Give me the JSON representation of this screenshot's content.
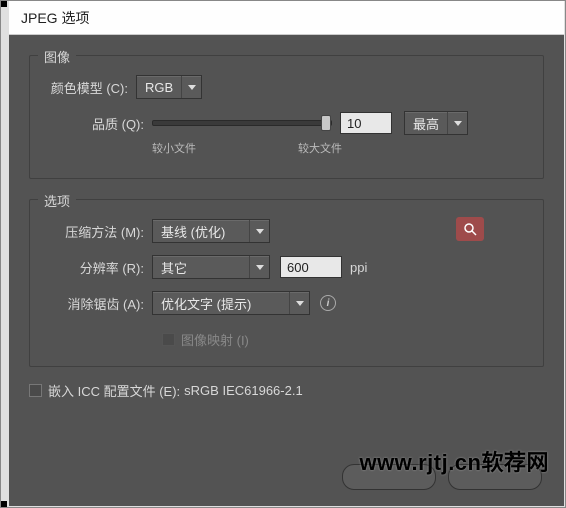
{
  "title": "JPEG 选项",
  "image_section": {
    "legend": "图像",
    "color_model_label": "颜色模型 (C):",
    "color_model_value": "RGB",
    "quality_label": "品质 (Q):",
    "quality_value": "10",
    "quality_preset": "最高",
    "smaller_label": "较小文件",
    "larger_label": "较大文件"
  },
  "options_section": {
    "legend": "选项",
    "compression_label": "压缩方法 (M):",
    "compression_value": "基线 (优化)",
    "resolution_label": "分辨率 (R):",
    "resolution_select": "其它",
    "resolution_value": "600",
    "resolution_unit": "ppi",
    "antialias_label": "消除锯齿 (A):",
    "antialias_value": "优化文字 (提示)",
    "imagemap_label": "图像映射 (I)"
  },
  "embed": {
    "label": "嵌入 ICC 配置文件 (E):",
    "profile": "sRGB IEC61966-2.1"
  },
  "watermark": "www.rjtj.cn软荐网"
}
